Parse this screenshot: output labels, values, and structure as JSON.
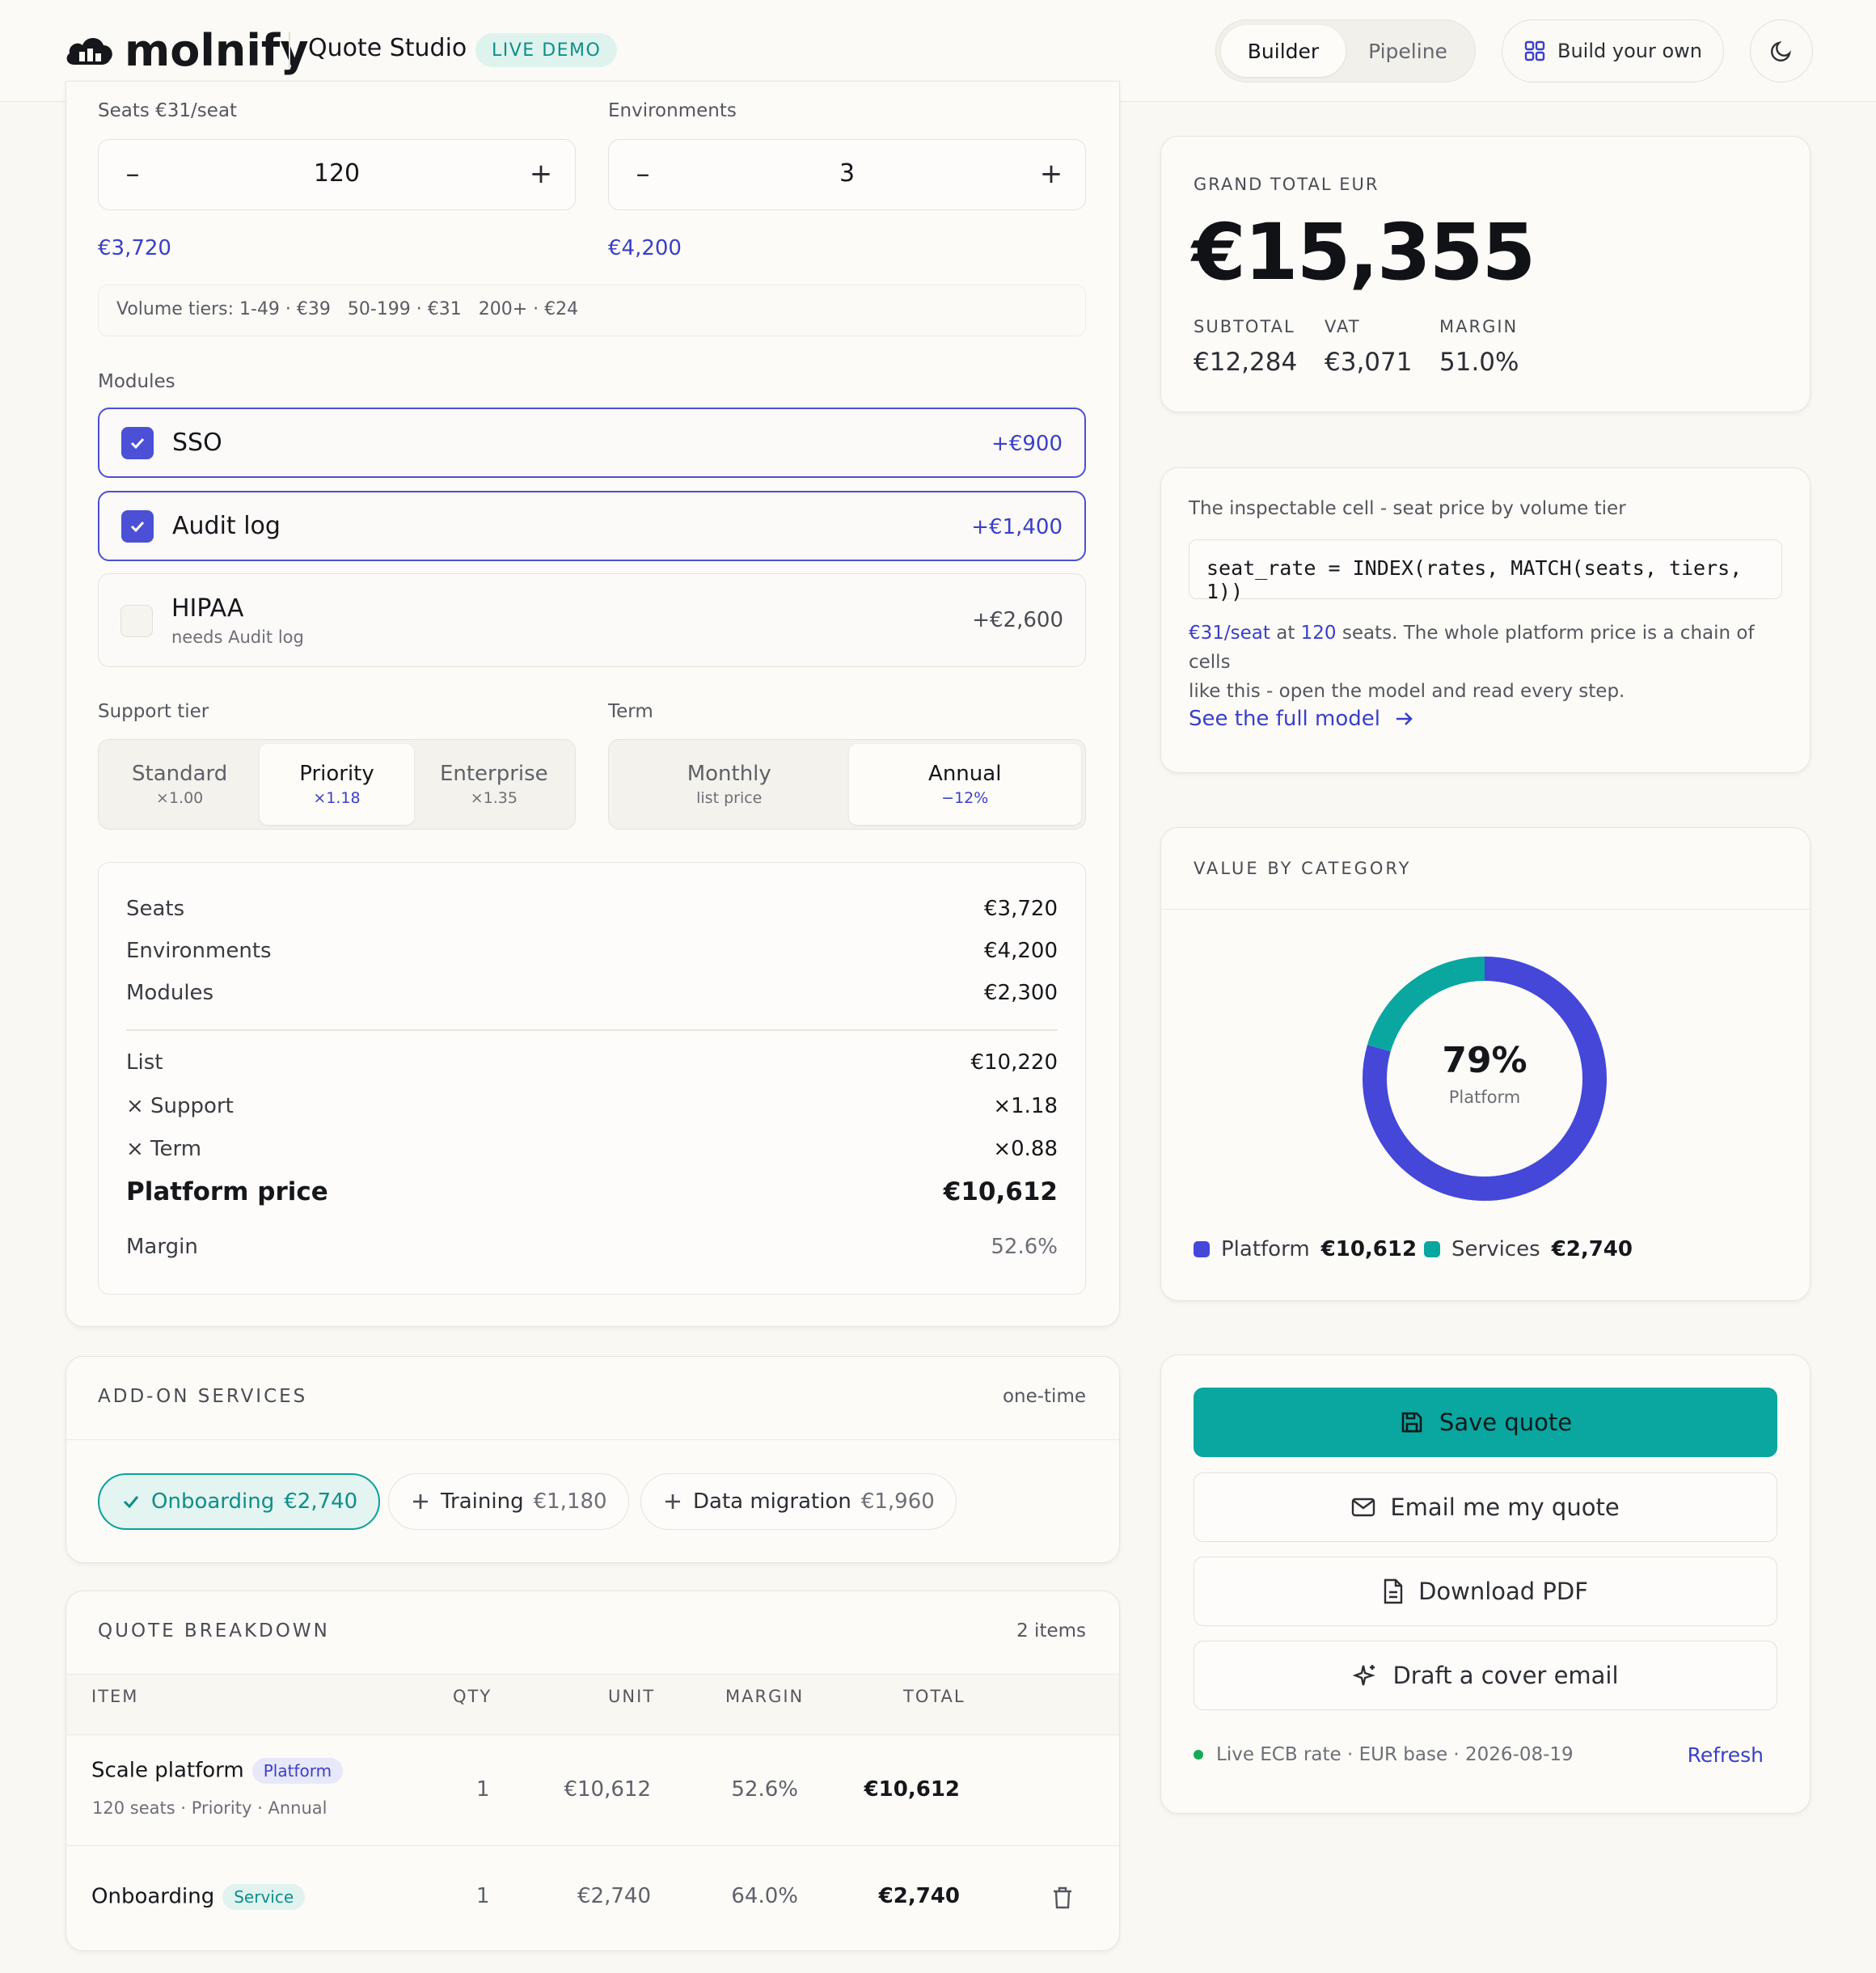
{
  "header": {
    "brand": "molnify",
    "app_title": "Quote Studio",
    "badge": "LIVE DEMO",
    "tabs": [
      {
        "label": "Builder",
        "active": true
      },
      {
        "label": "Pipeline",
        "active": false
      }
    ],
    "build_label": "Build your own"
  },
  "config": {
    "seats": {
      "label": "Seats €31/seat",
      "value": "120",
      "amount": "€3,720"
    },
    "environments": {
      "label": "Environments",
      "value": "3",
      "amount": "€4,200"
    },
    "volume_tiers": "Volume tiers: 1-49 · €39   50-199 · €31   200+ · €24",
    "modules_label": "Modules",
    "modules": [
      {
        "name": "SSO",
        "price": "+€900",
        "checked": true,
        "note": ""
      },
      {
        "name": "Audit log",
        "price": "+€1,400",
        "checked": true,
        "note": ""
      },
      {
        "name": "HIPAA",
        "price": "+€2,600",
        "checked": false,
        "note": "needs Audit log"
      }
    ],
    "support_label": "Support tier",
    "support": [
      {
        "title": "Standard",
        "sub": "×1.00",
        "active": false
      },
      {
        "title": "Priority",
        "sub": "×1.18",
        "active": true
      },
      {
        "title": "Enterprise",
        "sub": "×1.35",
        "active": false
      }
    ],
    "term_label": "Term",
    "term": [
      {
        "title": "Monthly",
        "sub": "list price",
        "active": false
      },
      {
        "title": "Annual",
        "sub": "−12%",
        "active": true
      }
    ]
  },
  "summary": {
    "rows": [
      {
        "label": "Seats",
        "value": "€3,720"
      },
      {
        "label": "Environments",
        "value": "€4,200"
      },
      {
        "label": "Modules",
        "value": "€2,300"
      }
    ],
    "list": {
      "label": "List",
      "value": "€10,220"
    },
    "support": {
      "label": "× Support",
      "value": "×1.18"
    },
    "term": {
      "label": "× Term",
      "value": "×0.88"
    },
    "platform_price": {
      "label": "Platform price",
      "value": "€10,612"
    },
    "margin": {
      "label": "Margin",
      "value": "52.6%"
    }
  },
  "addons": {
    "title": "ADD-ON SERVICES",
    "note": "one-time",
    "items": [
      {
        "name": "Onboarding",
        "price": "€2,740",
        "selected": true
      },
      {
        "name": "Training",
        "price": "€1,180",
        "selected": false
      },
      {
        "name": "Data migration",
        "price": "€1,960",
        "selected": false
      }
    ]
  },
  "breakdown": {
    "title": "QUOTE BREAKDOWN",
    "count": "2 items",
    "columns": [
      "ITEM",
      "QTY",
      "UNIT",
      "MARGIN",
      "TOTAL"
    ],
    "rows": [
      {
        "item": "Scale platform",
        "tag": "Platform",
        "detail": "120 seats · Priority · Annual",
        "qty": "1",
        "unit": "€10,612",
        "margin": "52.6%",
        "total": "€10,612"
      },
      {
        "item": "Onboarding",
        "tag": "Service",
        "detail": "",
        "qty": "1",
        "unit": "€2,740",
        "margin": "64.0%",
        "total": "€2,740"
      }
    ]
  },
  "totals": {
    "label": "GRAND TOTAL EUR",
    "grand_total": "€15,355",
    "subtotal_label": "SUBTOTAL",
    "subtotal": "€12,284",
    "vat_label": "VAT",
    "vat": "€3,071",
    "margin_label": "MARGIN",
    "margin": "51.0%"
  },
  "inspect": {
    "caption": "The inspectable cell - seat price by volume tier",
    "formula": "seat_rate = INDEX(rates, MATCH(seats, tiers, 1))",
    "rate": "€31/seat",
    "at": "at",
    "seats": "120",
    "desc1": "seats. The whole platform price is a chain of cells",
    "desc2": "like this - open the model and read every step.",
    "link": "See the full model"
  },
  "category": {
    "title": "VALUE BY CATEGORY",
    "center_value": "79%",
    "center_label": "Platform",
    "legend": [
      {
        "name": "Platform",
        "value": "€10,612",
        "color": "#4447d8"
      },
      {
        "name": "Services",
        "value": "€2,740",
        "color": "#0aa6a0"
      }
    ]
  },
  "chart_data": {
    "type": "pie",
    "categories": [
      "Platform",
      "Services"
    ],
    "values": [
      10612,
      2740
    ],
    "colors": [
      "#4447d8",
      "#0aa6a0"
    ]
  },
  "actions": {
    "save": "Save quote",
    "email": "Email me my quote",
    "pdf": "Download PDF",
    "draft": "Draft a cover email",
    "status": "Live ECB rate · EUR base · 2026-08-19",
    "refresh": "Refresh"
  }
}
